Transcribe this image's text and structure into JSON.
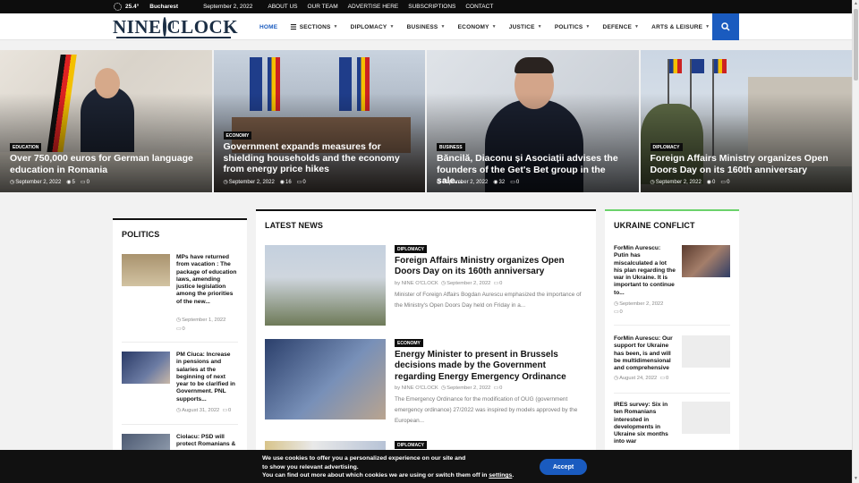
{
  "topbar": {
    "temperature": "25.4",
    "temp_unit": "°",
    "city": "Bucharest",
    "date": "September 2, 2022",
    "links": [
      "ABOUT US",
      "OUR TEAM",
      "ADVERTISE HERE",
      "SUBSCRIPTIONS",
      "CONTACT"
    ]
  },
  "header": {
    "logo_text_left": "NINE",
    "logo_text_right": "CLOCK",
    "nav": [
      {
        "label": "HOME",
        "active": true
      },
      {
        "label": "SECTIONS"
      },
      {
        "label": "DIPLOMACY"
      },
      {
        "label": "BUSINESS"
      },
      {
        "label": "ECONOMY"
      },
      {
        "label": "JUSTICE"
      },
      {
        "label": "POLITICS"
      },
      {
        "label": "DEFENCE"
      },
      {
        "label": "ARTS & LEISURE"
      }
    ]
  },
  "hero": [
    {
      "category": "EDUCATION",
      "title": "Over 750,000 euros for German language education in Romania",
      "date": "September 2, 2022",
      "views": "5",
      "comments": "0"
    },
    {
      "category": "ECONOMY",
      "title": "Government expands measures for shielding households and the economy from energy price hikes",
      "date": "September 2, 2022",
      "views": "16",
      "comments": "0"
    },
    {
      "category": "BUSINESS",
      "title": "Băncilă, Diaconu și Asociații advises the founders of the Get's Bet group in the sale...",
      "date": "September 2, 2022",
      "views": "32",
      "comments": "0"
    },
    {
      "category": "DIPLOMACY",
      "title": "Foreign Affairs Ministry organizes Open Doors Day on its 160th anniversary",
      "date": "September 2, 2022",
      "views": "0",
      "comments": "0"
    }
  ],
  "politics": {
    "title": "POLITICS",
    "items": [
      {
        "title": "MPs have returned from vacation : The package of education laws, amending justice legislation among the priorities of the new...",
        "date": "September 1, 2022",
        "comments": "0"
      },
      {
        "title": "PM Ciuca: Increase in pensions and salaries at the beginning of next year to be clarified in Government. PNL supports...",
        "date": "August 31, 2022",
        "comments": "0"
      },
      {
        "title": "Ciolacu: PSD will protect Romanians &"
      }
    ]
  },
  "latest": {
    "title": "LATEST NEWS",
    "items": [
      {
        "category": "DIPLOMACY",
        "title": "Foreign Affairs Ministry organizes Open Doors Day on its 160th anniversary",
        "author": "NINE O'CLOCK",
        "date": "September 2, 2022",
        "comments": "0",
        "excerpt": "Minister of Foreign Affairs Bogdan Aurescu emphasized the importance of the Ministry's Open Doors Day held on Friday in a..."
      },
      {
        "category": "ECONOMY",
        "title": "Energy Minister to present in Brussels decisions made by the Government regarding Energy Emergency Ordinance",
        "author": "NINE O'CLOCK",
        "date": "September 2, 2022",
        "comments": "0",
        "excerpt": "The Emergency Ordinance for the modification of OUG (government emergency ordinance) 27/2022 was inspired by models approved by the European..."
      },
      {
        "category": "DIPLOMACY"
      }
    ]
  },
  "ukraine": {
    "title": "UKRAINE CONFLICT",
    "items": [
      {
        "title": "ForMin Aurescu: Putin has miscalculated a lot his plan regarding the war in Ukraine. It is important to continue to...",
        "date": "September 2, 2022",
        "comments": "0"
      },
      {
        "title": "ForMin Aurescu: Our support for Ukraine has been, is and will be multidimensional and comprehensive",
        "date": "August 24, 2022",
        "comments": "0"
      },
      {
        "title": "IRES survey: Six in ten Romanians interested in developments in Ukraine six months into war"
      }
    ]
  },
  "cookie": {
    "line1": "We use cookies to offer you a personalized  experience on our site and",
    "line2": "to show you relevant advertising.",
    "line3": "You can find out more about which cookies we are using or switch them off in",
    "link": "settings",
    "accept": "Accept"
  },
  "colors": {
    "accent": "#1a5bbf",
    "ukraine_accent": "#6bd26b"
  }
}
